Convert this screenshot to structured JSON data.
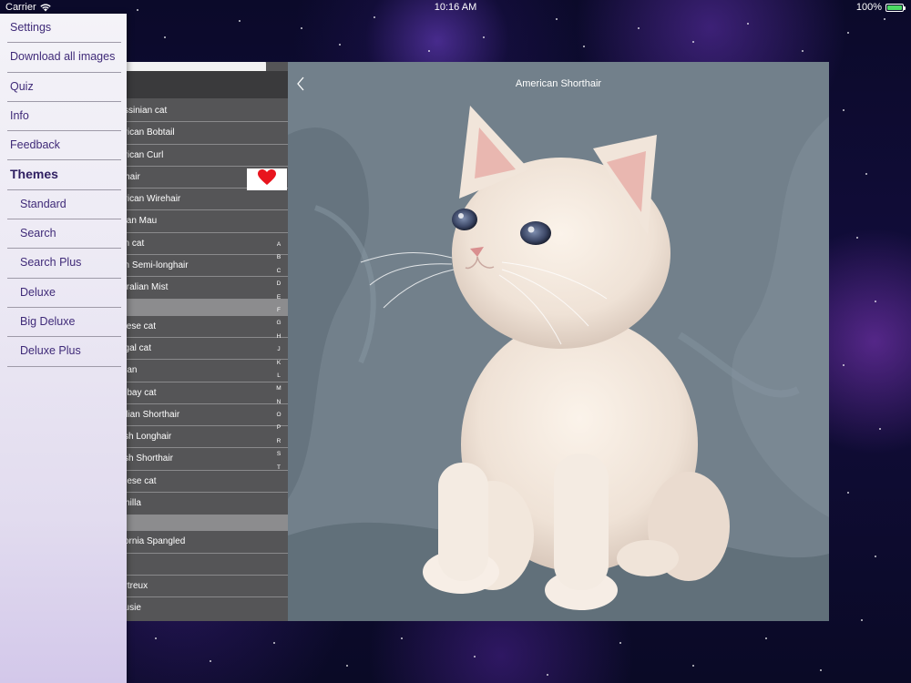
{
  "status_bar": {
    "carrier": "Carrier",
    "time": "10:16 AM",
    "battery": "100%",
    "battery_level": 1.0
  },
  "drawer": {
    "items": [
      {
        "label": "Settings",
        "kind": "item"
      },
      {
        "label": "Download all images",
        "kind": "item"
      },
      {
        "label": "Quiz",
        "kind": "item"
      },
      {
        "label": "Info",
        "kind": "item"
      },
      {
        "label": "Feedback",
        "kind": "item"
      },
      {
        "label": "Themes",
        "kind": "header"
      },
      {
        "label": "Standard",
        "kind": "sub"
      },
      {
        "label": "Search",
        "kind": "sub"
      },
      {
        "label": "Search Plus",
        "kind": "sub"
      },
      {
        "label": "Deluxe",
        "kind": "sub"
      },
      {
        "label": "Big Deluxe",
        "kind": "sub"
      },
      {
        "label": "Deluxe Plus",
        "kind": "sub"
      }
    ]
  },
  "list": {
    "header_icon": "cat-icon",
    "rows": [
      {
        "label": "yssinian cat"
      },
      {
        "label": "erican Bobtail"
      },
      {
        "label": "erican Curl"
      },
      {
        "label": "rthair",
        "favorite": true
      },
      {
        "label": "erican Wirehair"
      },
      {
        "label": "bian Mau"
      },
      {
        "label": "an cat"
      },
      {
        "label": "an Semi-longhair"
      },
      {
        "label": "stralian Mist"
      },
      {
        "label": "",
        "section": true
      },
      {
        "label": "inese cat"
      },
      {
        "label": "ngal cat"
      },
      {
        "label": "man"
      },
      {
        "label": "mbay cat"
      },
      {
        "label": "zilian Shorthair"
      },
      {
        "label": "tish Longhair"
      },
      {
        "label": "tish Shorthair"
      },
      {
        "label": "mese cat"
      },
      {
        "label": "rmilla",
        "noline": true
      },
      {
        "label": "",
        "section": true
      },
      {
        "label": "ifornia Spangled"
      },
      {
        "label": ""
      },
      {
        "label": "artreux"
      },
      {
        "label": "ausie",
        "noline": true
      }
    ],
    "index_letters": [
      "A",
      "B",
      "C",
      "D",
      "E",
      "F",
      "G",
      "H",
      "J",
      "K",
      "L",
      "M",
      "N",
      "O",
      "P",
      "R",
      "S",
      "T"
    ],
    "favorite_icon": "heart-icon"
  },
  "detail": {
    "title": "American Shorthair",
    "back_icon": "chevron-left-icon",
    "image_subject": "white kitten"
  },
  "colors": {
    "accent_text": "#3f2a78",
    "heart": "#e8141d",
    "list_bg": "#555557"
  }
}
